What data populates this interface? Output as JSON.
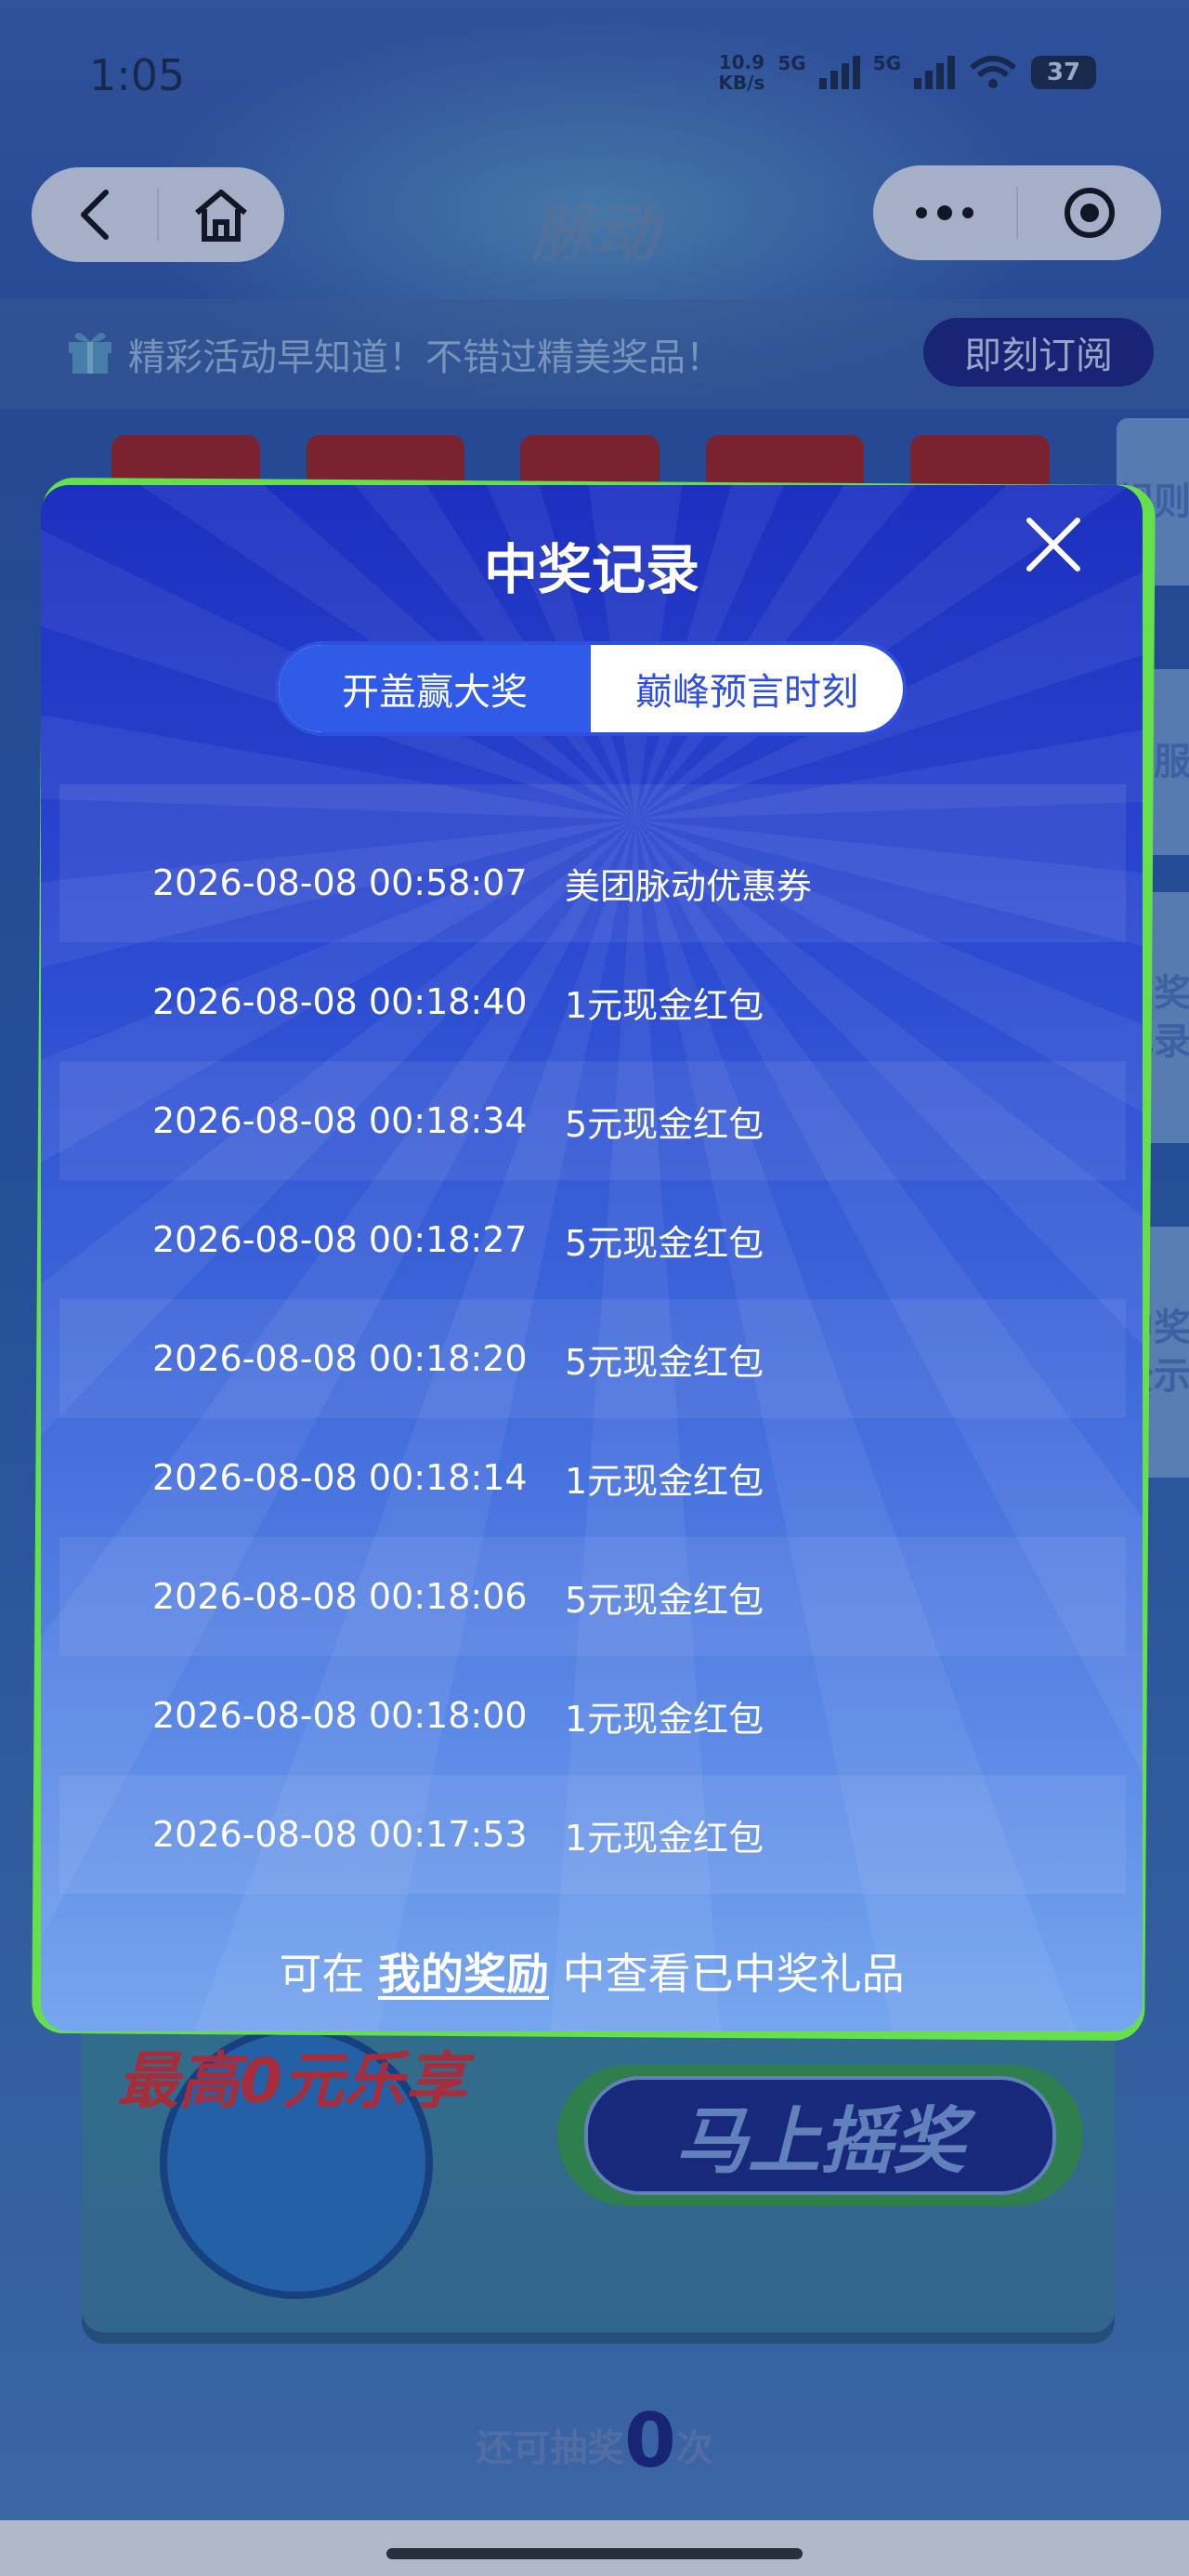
{
  "status_bar": {
    "time": "1:05",
    "net_speed_value": "10.9",
    "net_speed_unit": "KB/s",
    "signal_label_1": "5G",
    "signal_label_2": "5G",
    "battery": "37"
  },
  "nav": {
    "app_name": "脉动"
  },
  "subscribe_bar": {
    "text": "精彩活动早知道！不错过精美奖品！",
    "button": "即刻订阅"
  },
  "side_tabs": [
    "规则",
    "客服",
    "中奖记录",
    "中奖公示"
  ],
  "game": {
    "promo": "最高0元乐享",
    "shake_button": "马上摇奖",
    "remaining_prefix": "还可抽奖",
    "remaining_count": "0",
    "remaining_suffix": "次"
  },
  "modal": {
    "title": "中奖记录",
    "tabs": [
      {
        "label": "开盖赢大奖",
        "active": true
      },
      {
        "label": "巅峰预言时刻",
        "active": false
      }
    ],
    "records": [
      {
        "time": "2026-08-08 00:58:07",
        "prize": "美团脉动优惠券"
      },
      {
        "time": "2026-08-08 00:18:40",
        "prize": "1元现金红包"
      },
      {
        "time": "2026-08-08 00:18:34",
        "prize": "5元现金红包"
      },
      {
        "time": "2026-08-08 00:18:27",
        "prize": "5元现金红包"
      },
      {
        "time": "2026-08-08 00:18:20",
        "prize": "5元现金红包"
      },
      {
        "time": "2026-08-08 00:18:14",
        "prize": "1元现金红包"
      },
      {
        "time": "2026-08-08 00:18:06",
        "prize": "5元现金红包"
      },
      {
        "time": "2026-08-08 00:18:00",
        "prize": "1元现金红包"
      },
      {
        "time": "2026-08-08 00:17:53",
        "prize": "1元现金红包"
      }
    ],
    "footer_prefix": "可在",
    "footer_link": "我的奖励",
    "footer_suffix": "中查看已中奖礼品"
  },
  "colors": {
    "modal_top": "#1d2fc0",
    "modal_bottom": "#76a6ee",
    "modal_border": "#66e04a",
    "tab_active": "#2f5be8",
    "subscribe_button": "#1a2380"
  },
  "icons": [
    "back-icon",
    "home-icon",
    "more-icon",
    "target-icon",
    "gift-icon",
    "close-icon",
    "wifi-icon",
    "battery-icon",
    "signal-icon"
  ]
}
